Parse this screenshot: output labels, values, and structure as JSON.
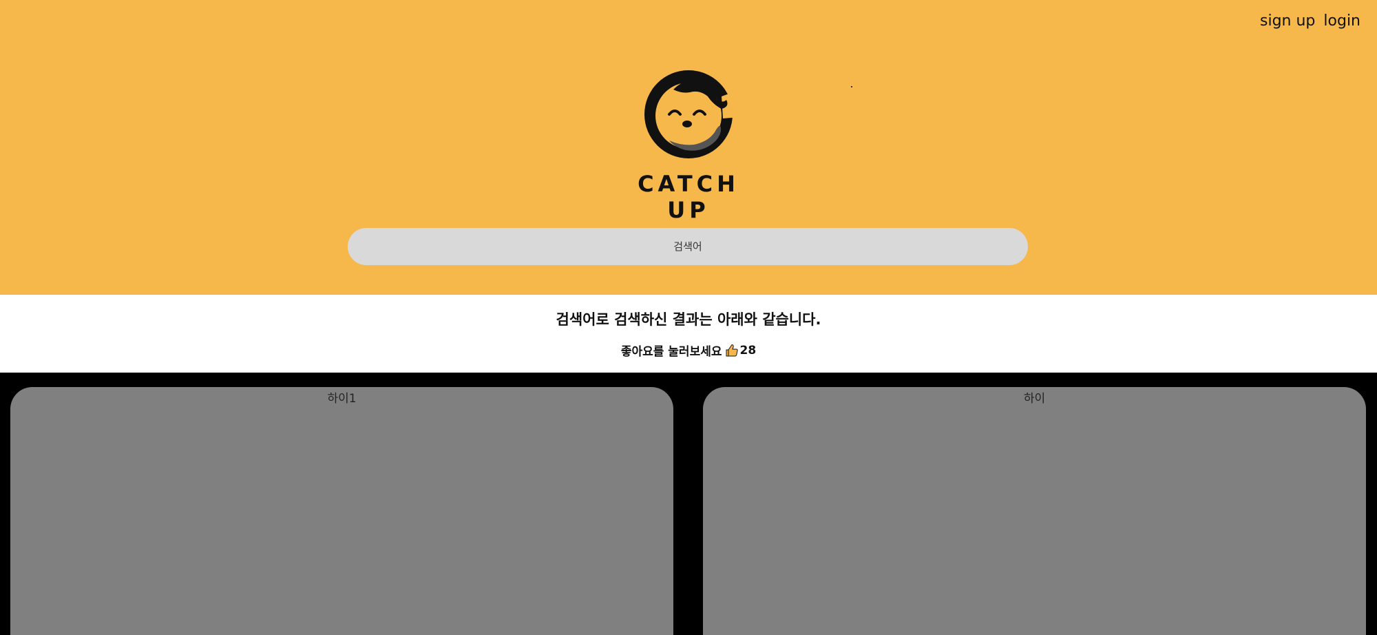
{
  "header": {
    "auth": {
      "signup_label": "sign up",
      "login_label": "login"
    },
    "logo": {
      "text": "CATCH UP",
      "icon": "smiling-face-c-logo"
    },
    "search": {
      "placeholder": "검색어"
    },
    "background_color": "#F6B84B"
  },
  "results": {
    "heading": "검색어로 검색하신 결과는 아래와 같습니다.",
    "like_prompt": "좋아요를 눌러보세요",
    "like_icon": "thumbs-up-icon",
    "like_count": "28"
  },
  "cards": [
    {
      "title": "하이1"
    },
    {
      "title": "하이"
    }
  ],
  "colors": {
    "accent": "#F6B84B",
    "search_bg": "#D9D9D9",
    "card_bg": "#808080",
    "cards_area_bg": "#000000"
  }
}
